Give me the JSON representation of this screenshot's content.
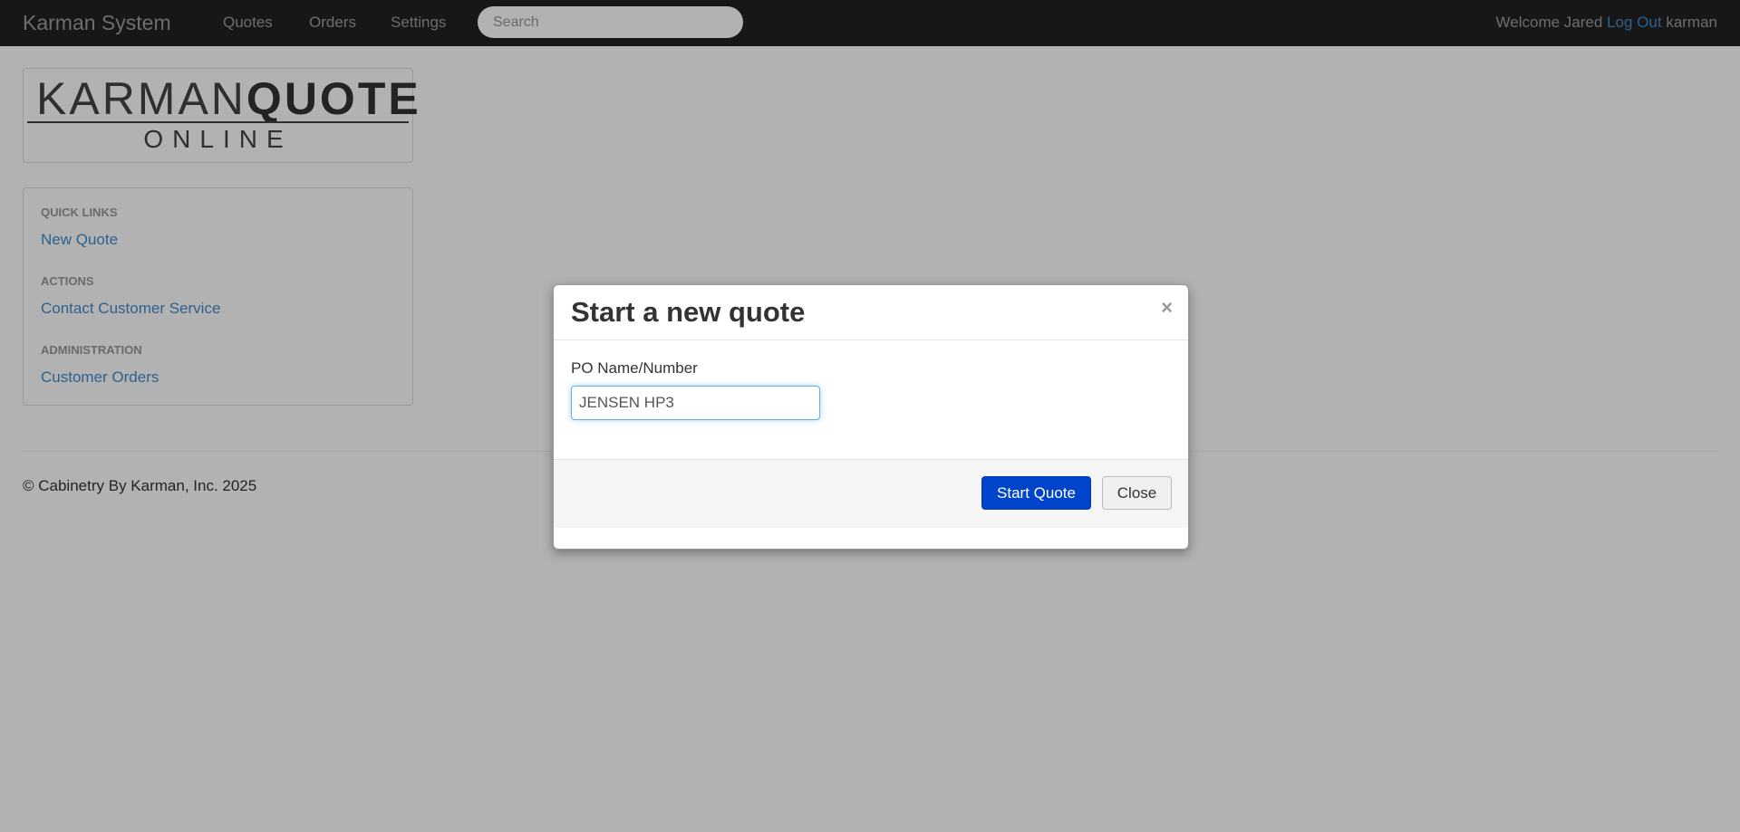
{
  "navbar": {
    "brand": "Karman System",
    "links": [
      "Quotes",
      "Orders",
      "Settings"
    ],
    "search_placeholder": "Search",
    "welcome": "Welcome Jared",
    "logout": "Log Out",
    "username": "karman"
  },
  "logo": {
    "word1": "KARMAN",
    "word2": "QUOTE",
    "tagline": "ONLINE"
  },
  "sidebar": {
    "sections": [
      {
        "header": "QUICK LINKS",
        "link": "New Quote"
      },
      {
        "header": "ACTIONS",
        "link": "Contact Customer Service"
      },
      {
        "header": "ADMINISTRATION",
        "link": "Customer Orders"
      }
    ]
  },
  "footer": {
    "copyright": "© Cabinetry By Karman, Inc. 2025"
  },
  "modal": {
    "title": "Start a new quote",
    "close_glyph": "×",
    "field_label": "PO Name/Number",
    "field_value": "JENSEN HP3",
    "primary_button": "Start Quote",
    "secondary_button": "Close"
  },
  "colors": {
    "navbar_bg": "#222222",
    "link": "#428bca",
    "primary_button": "#0044cc"
  }
}
